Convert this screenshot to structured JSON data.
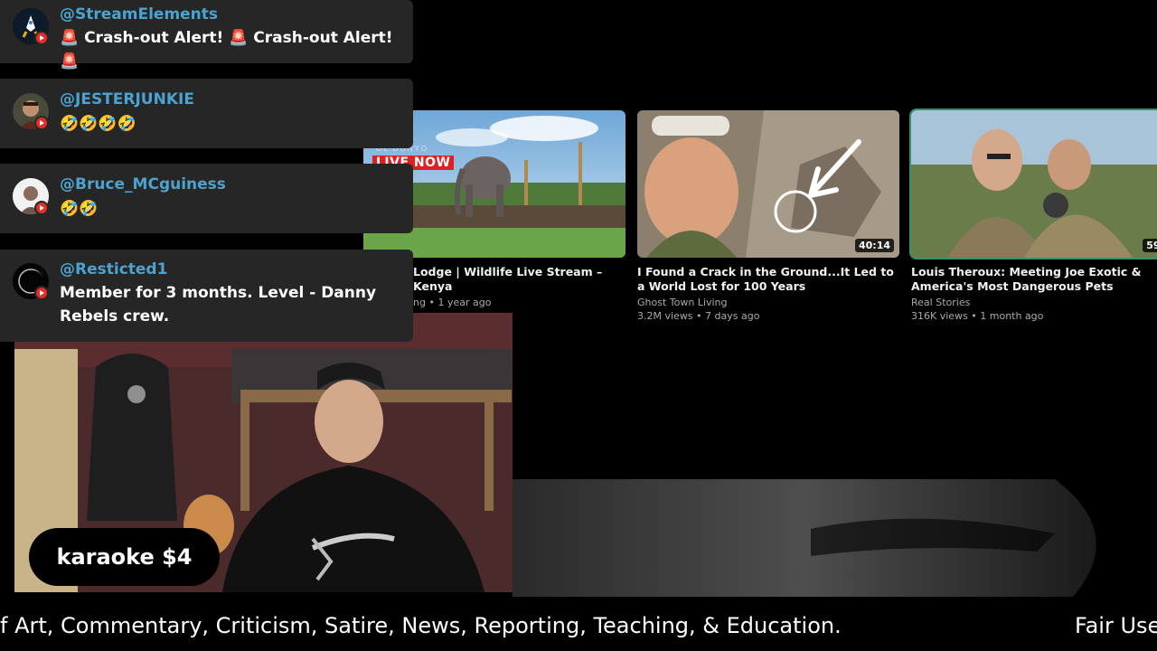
{
  "chat": [
    {
      "username": "@StreamElements",
      "message": "🚨 Crash-out Alert! 🚨 Crash-out Alert! 🚨",
      "avatar_icon": "rocket-avatar-icon"
    },
    {
      "username": "@JESTERJUNKIE",
      "message": "🤣🤣🤣🤣",
      "avatar_icon": "jester-avatar-icon"
    },
    {
      "username": "@Bruce_MCguiness",
      "message": "🤣🤣",
      "avatar_icon": "bruce-avatar-icon"
    },
    {
      "username": "@Resticted1",
      "message": "Member for 3 months. Level - Danny Rebels crew.",
      "avatar_icon": "eclipse-avatar-icon"
    }
  ],
  "videos": [
    {
      "title": "Lodge | Wildlife Live Stream – Kenya",
      "channel": "ng",
      "meta": "• 1 year ago",
      "live_label": "LIVE NOW",
      "live_sub": "OL DONYO"
    },
    {
      "title": "I Found a Crack in the Ground...It Led to a World Lost for 100 Years",
      "channel": "Ghost Town Living",
      "meta": "3.2M views • 7 days ago",
      "duration": "40:14"
    },
    {
      "title": "Louis Theroux: Meeting Joe Exotic & America's Most Dangerous Pets",
      "channel": "Real Stories",
      "meta": "316K views • 1 month ago",
      "duration": "59:"
    }
  ],
  "overlay": {
    "karaoke_label": "karaoke $4"
  },
  "ticker": {
    "segment_1": "f Art, Commentary, Criticism, Satire, News, Reporting, Teaching, & Education.",
    "segment_2": "Fair Use"
  },
  "colors": {
    "chat_bg": "#262626",
    "username": "#4aa3d1",
    "youtube_red": "#e52d27",
    "page_bg": "#000000"
  }
}
